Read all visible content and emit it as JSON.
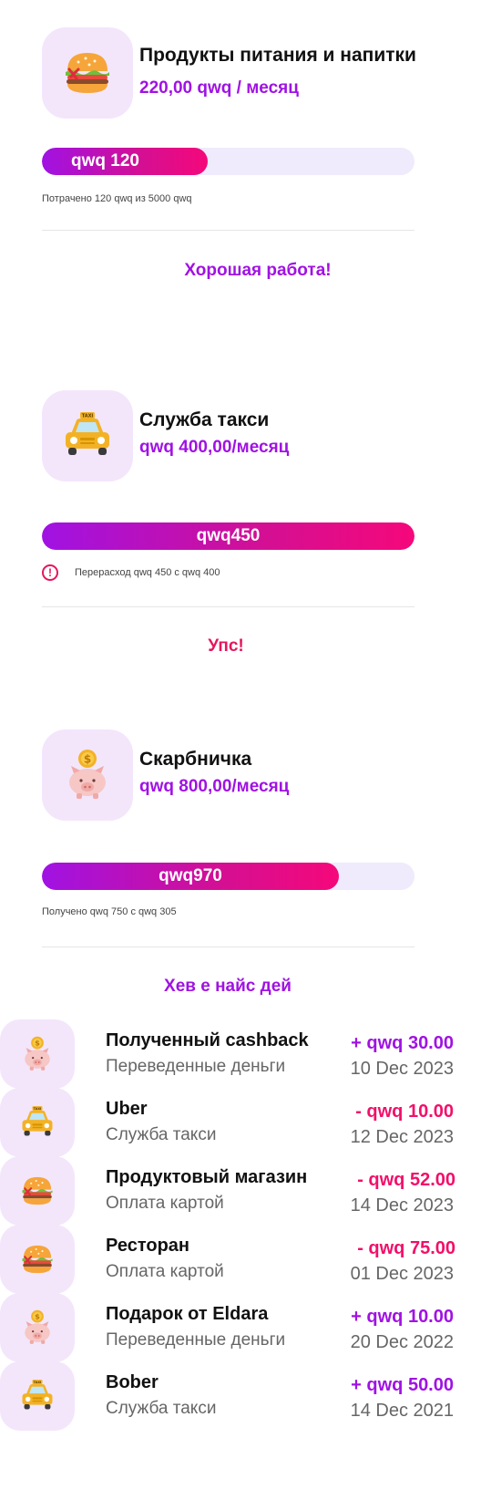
{
  "budgets": [
    {
      "icon": "burger-icon",
      "title": "Продукты питания и напитки",
      "amount": "220,00 qwq / месяц",
      "bar_label": "qwq 120",
      "progress": 0.45,
      "note": "Потрачено 120 qwq из 5000 qwq",
      "message": "Хорошая работа!",
      "message_color": "#a012e3"
    },
    {
      "icon": "taxi-icon",
      "title": "Служба такси",
      "amount": "qwq 400,00/месяц",
      "bar_label": "qwq450",
      "progress": 1.0,
      "note": "Перерасход qwq 450 с qwq 400",
      "message": "Упс!",
      "message_color": "#e6155d"
    },
    {
      "icon": "piggy-bank-icon",
      "title": "Скарбничка",
      "amount": "qwq 800,00/месяц",
      "bar_label": "qwq970",
      "progress": 0.8,
      "note": "Получено qwq 750 с qwq 305",
      "message": "Хев е найс дей",
      "message_color": "#a012e3"
    }
  ],
  "transactions": [
    {
      "icon": "piggy-bank-icon",
      "title": "Полученный cashback",
      "subtitle": "Переведенные деньги",
      "amount": "+ qwq 30.00",
      "date": "10 Dec 2023",
      "type": "positive"
    },
    {
      "icon": "taxi-icon",
      "title": "Uber",
      "subtitle": "Служба такси",
      "amount": "- qwq 10.00",
      "date": "12 Dec 2023",
      "type": "negative"
    },
    {
      "icon": "burger-icon",
      "title": "Продуктовый магазин",
      "subtitle": "Оплата картой",
      "amount": "- qwq 52.00",
      "date": "14 Dec 2023",
      "type": "negative"
    },
    {
      "icon": "burger-icon",
      "title": "Ресторан",
      "subtitle": "Оплата картой",
      "amount": "- qwq 75.00",
      "date": "01 Dec 2023",
      "type": "negative"
    },
    {
      "icon": "piggy-bank-icon",
      "title": "Подарок от Eldara",
      "subtitle": "Переведенные деньги",
      "amount": "+ qwq 10.00",
      "date": "20 Dec 2022",
      "type": "positive"
    },
    {
      "icon": "taxi-icon",
      "title": "Bober",
      "subtitle": "Служба такси",
      "amount": "+ qwq 50.00",
      "date": "14 Dec 2021",
      "type": "positive"
    }
  ],
  "colors": {
    "accent": "#a012e3",
    "negative": "#f20f6a",
    "tile": "#f3e6fb",
    "track": "#efeafc"
  }
}
